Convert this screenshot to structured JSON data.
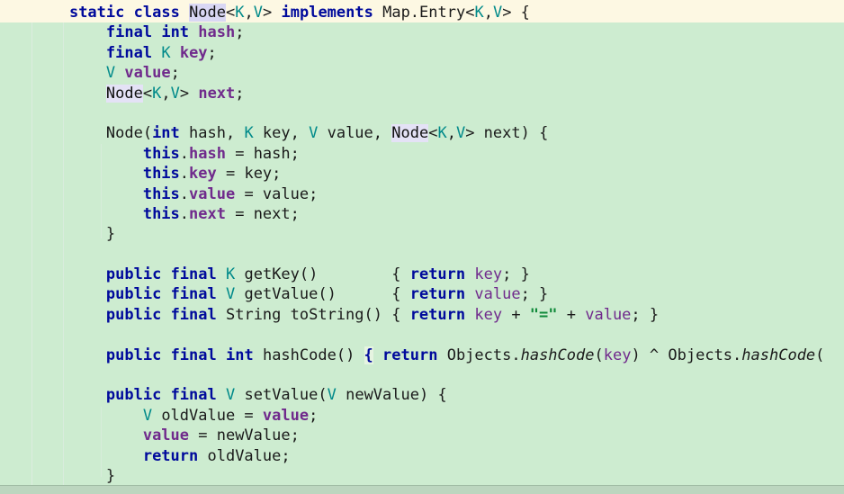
{
  "editor": {
    "language": "java",
    "theme_name": "green-light",
    "colors": {
      "background": "#cdecd0",
      "current_line": "#fdf8e3",
      "keyword": "#000a9c",
      "type_param": "#008a8a",
      "field": "#702a8c",
      "plain_text": "#1a1a1a",
      "string": "#108a3a",
      "occurrence_highlight": "#e4e2f6",
      "brace_match": "#e6f4e1",
      "indent_guide": "#dfeee1",
      "bottom_strip": "#bcd6bf"
    },
    "scrollbar": {
      "visible": false
    }
  },
  "code": {
    "lines": [
      {
        "id": "line-1-class-decl",
        "current": true,
        "tokens": [
          {
            "t": "    ",
            "c": "pln"
          },
          {
            "t": "static",
            "c": "kw"
          },
          {
            "t": " ",
            "c": "pln"
          },
          {
            "t": "class",
            "c": "kw"
          },
          {
            "t": " ",
            "c": "pln"
          },
          {
            "t": "Node",
            "c": "hl-occ-strong"
          },
          {
            "t": "<",
            "c": "pln"
          },
          {
            "t": "K",
            "c": "typ"
          },
          {
            "t": ",",
            "c": "pln"
          },
          {
            "t": "V",
            "c": "typ"
          },
          {
            "t": "> ",
            "c": "pln"
          },
          {
            "t": "implements",
            "c": "kw"
          },
          {
            "t": " Map.Entry<",
            "c": "pln"
          },
          {
            "t": "K",
            "c": "typ"
          },
          {
            "t": ",",
            "c": "pln"
          },
          {
            "t": "V",
            "c": "typ"
          },
          {
            "t": "> {",
            "c": "pln"
          }
        ]
      },
      {
        "id": "line-2-field-hash",
        "tokens": [
          {
            "t": "        ",
            "c": "pln"
          },
          {
            "t": "final",
            "c": "kw"
          },
          {
            "t": " ",
            "c": "pln"
          },
          {
            "t": "int",
            "c": "kw"
          },
          {
            "t": " ",
            "c": "pln"
          },
          {
            "t": "hash",
            "c": "fld"
          },
          {
            "t": ";",
            "c": "pln"
          }
        ]
      },
      {
        "id": "line-3-field-key",
        "tokens": [
          {
            "t": "        ",
            "c": "pln"
          },
          {
            "t": "final",
            "c": "kw"
          },
          {
            "t": " ",
            "c": "pln"
          },
          {
            "t": "K",
            "c": "typ"
          },
          {
            "t": " ",
            "c": "pln"
          },
          {
            "t": "key",
            "c": "fld"
          },
          {
            "t": ";",
            "c": "pln"
          }
        ]
      },
      {
        "id": "line-4-field-value",
        "tokens": [
          {
            "t": "        ",
            "c": "pln"
          },
          {
            "t": "V",
            "c": "typ"
          },
          {
            "t": " ",
            "c": "pln"
          },
          {
            "t": "value",
            "c": "fld"
          },
          {
            "t": ";",
            "c": "pln"
          }
        ]
      },
      {
        "id": "line-5-field-next",
        "tokens": [
          {
            "t": "        ",
            "c": "pln"
          },
          {
            "t": "Node",
            "c": "hl-occ"
          },
          {
            "t": "<",
            "c": "pln"
          },
          {
            "t": "K",
            "c": "typ"
          },
          {
            "t": ",",
            "c": "pln"
          },
          {
            "t": "V",
            "c": "typ"
          },
          {
            "t": "> ",
            "c": "pln"
          },
          {
            "t": "next",
            "c": "fld"
          },
          {
            "t": ";",
            "c": "pln"
          }
        ]
      },
      {
        "id": "line-6-blank",
        "tokens": []
      },
      {
        "id": "line-7-ctor-signature",
        "tokens": [
          {
            "t": "        Node(",
            "c": "pln"
          },
          {
            "t": "int",
            "c": "kw"
          },
          {
            "t": " hash, ",
            "c": "pln"
          },
          {
            "t": "K",
            "c": "typ"
          },
          {
            "t": " key, ",
            "c": "pln"
          },
          {
            "t": "V",
            "c": "typ"
          },
          {
            "t": " value, ",
            "c": "pln"
          },
          {
            "t": "Node",
            "c": "hl-occ"
          },
          {
            "t": "<",
            "c": "pln"
          },
          {
            "t": "K",
            "c": "typ"
          },
          {
            "t": ",",
            "c": "pln"
          },
          {
            "t": "V",
            "c": "typ"
          },
          {
            "t": "> next) {",
            "c": "pln"
          }
        ]
      },
      {
        "id": "line-8-assign-hash",
        "tokens": [
          {
            "t": "            ",
            "c": "pln"
          },
          {
            "t": "this",
            "c": "kw"
          },
          {
            "t": ".",
            "c": "pln"
          },
          {
            "t": "hash",
            "c": "fld"
          },
          {
            "t": " = hash;",
            "c": "pln"
          }
        ]
      },
      {
        "id": "line-9-assign-key",
        "tokens": [
          {
            "t": "            ",
            "c": "pln"
          },
          {
            "t": "this",
            "c": "kw"
          },
          {
            "t": ".",
            "c": "pln"
          },
          {
            "t": "key",
            "c": "fld"
          },
          {
            "t": " = key;",
            "c": "pln"
          }
        ]
      },
      {
        "id": "line-10-assign-value",
        "tokens": [
          {
            "t": "            ",
            "c": "pln"
          },
          {
            "t": "this",
            "c": "kw"
          },
          {
            "t": ".",
            "c": "pln"
          },
          {
            "t": "value",
            "c": "fld"
          },
          {
            "t": " = value;",
            "c": "pln"
          }
        ]
      },
      {
        "id": "line-11-assign-next",
        "tokens": [
          {
            "t": "            ",
            "c": "pln"
          },
          {
            "t": "this",
            "c": "kw"
          },
          {
            "t": ".",
            "c": "pln"
          },
          {
            "t": "next",
            "c": "fld"
          },
          {
            "t": " = next;",
            "c": "pln"
          }
        ]
      },
      {
        "id": "line-12-ctor-close",
        "tokens": [
          {
            "t": "        }",
            "c": "pln"
          }
        ]
      },
      {
        "id": "line-13-blank",
        "tokens": []
      },
      {
        "id": "line-14-getkey",
        "tokens": [
          {
            "t": "        ",
            "c": "pln"
          },
          {
            "t": "public",
            "c": "kw"
          },
          {
            "t": " ",
            "c": "pln"
          },
          {
            "t": "final",
            "c": "kw"
          },
          {
            "t": " ",
            "c": "pln"
          },
          {
            "t": "K",
            "c": "typ"
          },
          {
            "t": " getKey()        { ",
            "c": "pln"
          },
          {
            "t": "return",
            "c": "kw"
          },
          {
            "t": " ",
            "c": "pln"
          },
          {
            "t": "key",
            "c": "fld-plain"
          },
          {
            "t": "; }",
            "c": "pln"
          }
        ]
      },
      {
        "id": "line-15-getvalue",
        "tokens": [
          {
            "t": "        ",
            "c": "pln"
          },
          {
            "t": "public",
            "c": "kw"
          },
          {
            "t": " ",
            "c": "pln"
          },
          {
            "t": "final",
            "c": "kw"
          },
          {
            "t": " ",
            "c": "pln"
          },
          {
            "t": "V",
            "c": "typ"
          },
          {
            "t": " getValue()      { ",
            "c": "pln"
          },
          {
            "t": "return",
            "c": "kw"
          },
          {
            "t": " ",
            "c": "pln"
          },
          {
            "t": "value",
            "c": "fld-plain"
          },
          {
            "t": "; }",
            "c": "pln"
          }
        ]
      },
      {
        "id": "line-16-tostring",
        "tokens": [
          {
            "t": "        ",
            "c": "pln"
          },
          {
            "t": "public",
            "c": "kw"
          },
          {
            "t": " ",
            "c": "pln"
          },
          {
            "t": "final",
            "c": "kw"
          },
          {
            "t": " String toString() { ",
            "c": "pln"
          },
          {
            "t": "return",
            "c": "kw"
          },
          {
            "t": " ",
            "c": "pln"
          },
          {
            "t": "key",
            "c": "fld-plain"
          },
          {
            "t": " + ",
            "c": "pln"
          },
          {
            "t": "\"=\"",
            "c": "str"
          },
          {
            "t": " + ",
            "c": "pln"
          },
          {
            "t": "value",
            "c": "fld-plain"
          },
          {
            "t": "; }",
            "c": "pln"
          }
        ]
      },
      {
        "id": "line-17-blank",
        "tokens": []
      },
      {
        "id": "line-18-hashcode",
        "tokens": [
          {
            "t": "        ",
            "c": "pln"
          },
          {
            "t": "public",
            "c": "kw"
          },
          {
            "t": " ",
            "c": "pln"
          },
          {
            "t": "final",
            "c": "kw"
          },
          {
            "t": " ",
            "c": "pln"
          },
          {
            "t": "int",
            "c": "kw"
          },
          {
            "t": " hashCode() ",
            "c": "pln"
          },
          {
            "t": "{",
            "c": "hl-brace"
          },
          {
            "t": " ",
            "c": "pln"
          },
          {
            "t": "return",
            "c": "kw"
          },
          {
            "t": " Objects.",
            "c": "pln"
          },
          {
            "t": "hashCode",
            "c": "stat"
          },
          {
            "t": "(",
            "c": "pln"
          },
          {
            "t": "key",
            "c": "fld-plain"
          },
          {
            "t": ") ^ Objects.",
            "c": "pln"
          },
          {
            "t": "hashCode",
            "c": "stat"
          },
          {
            "t": "(",
            "c": "pln"
          }
        ]
      },
      {
        "id": "line-19-blank",
        "tokens": []
      },
      {
        "id": "line-20-setvalue-signature",
        "tokens": [
          {
            "t": "        ",
            "c": "pln"
          },
          {
            "t": "public",
            "c": "kw"
          },
          {
            "t": " ",
            "c": "pln"
          },
          {
            "t": "final",
            "c": "kw"
          },
          {
            "t": " ",
            "c": "pln"
          },
          {
            "t": "V",
            "c": "typ"
          },
          {
            "t": " setValue(",
            "c": "pln"
          },
          {
            "t": "V",
            "c": "typ"
          },
          {
            "t": " newValue) {",
            "c": "pln"
          }
        ]
      },
      {
        "id": "line-21-oldvalue-decl",
        "tokens": [
          {
            "t": "            ",
            "c": "pln"
          },
          {
            "t": "V",
            "c": "typ"
          },
          {
            "t": " oldValue = ",
            "c": "pln"
          },
          {
            "t": "value",
            "c": "fld"
          },
          {
            "t": ";",
            "c": "pln"
          }
        ]
      },
      {
        "id": "line-22-assign-newvalue",
        "tokens": [
          {
            "t": "            ",
            "c": "pln"
          },
          {
            "t": "value",
            "c": "fld"
          },
          {
            "t": " = newValue;",
            "c": "pln"
          }
        ]
      },
      {
        "id": "line-23-return-oldvalue",
        "tokens": [
          {
            "t": "            ",
            "c": "pln"
          },
          {
            "t": "return",
            "c": "kw"
          },
          {
            "t": " oldValue;",
            "c": "pln"
          }
        ]
      },
      {
        "id": "line-24-setvalue-close",
        "tokens": [
          {
            "t": "        }",
            "c": "pln"
          }
        ]
      }
    ]
  }
}
